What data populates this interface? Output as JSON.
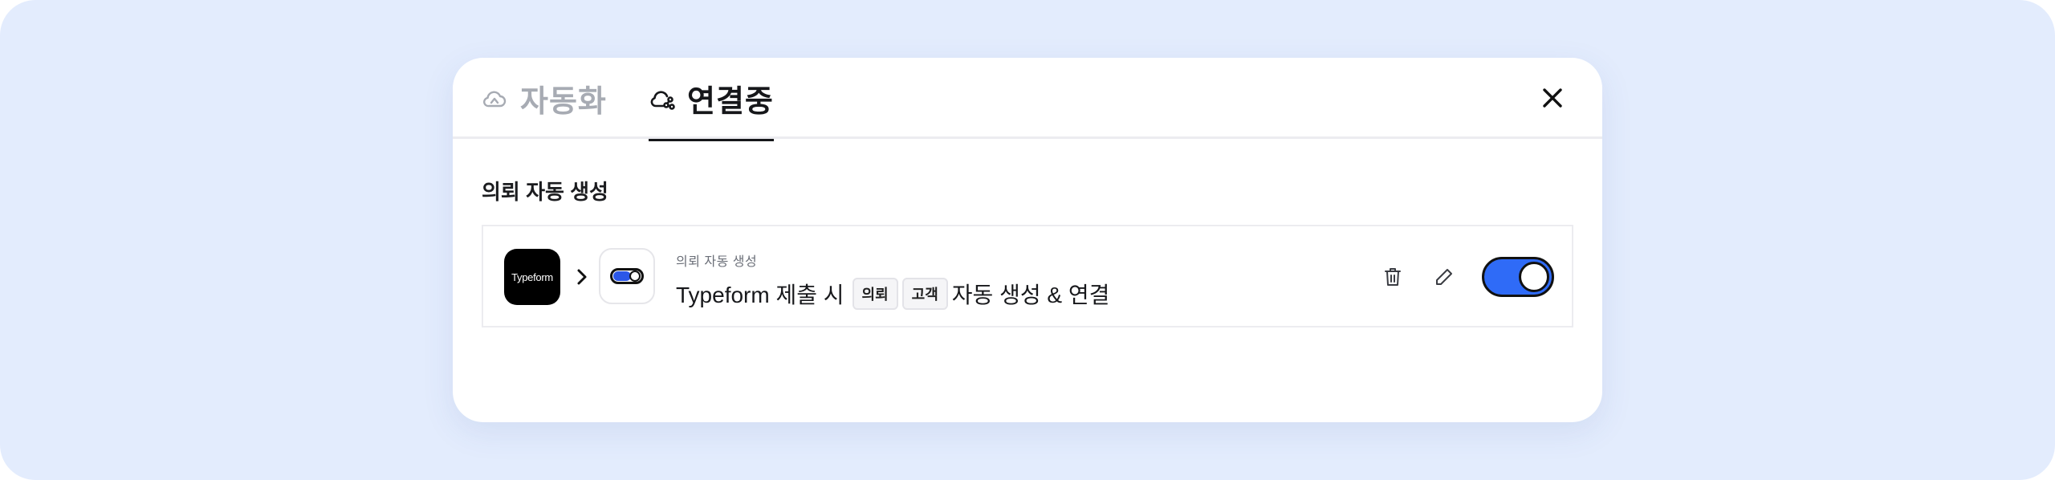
{
  "tabs": {
    "automation": {
      "label": "자동화",
      "icon": "cloud-icon"
    },
    "connecting": {
      "label": "연결중",
      "icon": "cloud-link-icon"
    }
  },
  "section": {
    "title": "의뢰 자동 생성"
  },
  "rule": {
    "source_logo_text": "Typeform",
    "subtitle": "의뢰 자동 생성",
    "text_prefix": "Typeform 제출 시",
    "chip_request": "의뢰",
    "chip_customer": "고객",
    "text_suffix": "자동 생성 & 연결",
    "enabled": true
  },
  "colors": {
    "backdrop": "#e3ecfd",
    "accent": "#2f6bf7",
    "tab_inactive": "#a7abb3"
  }
}
